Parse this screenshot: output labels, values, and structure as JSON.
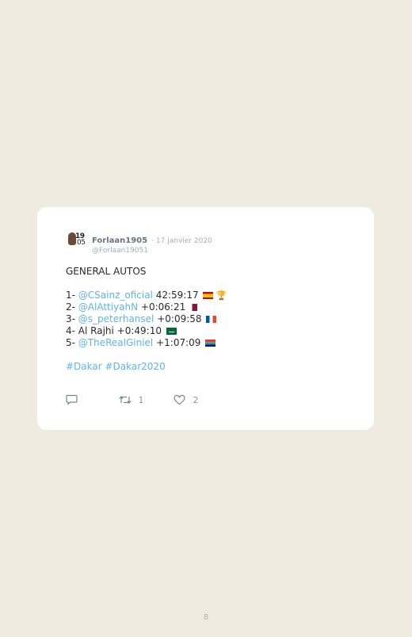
{
  "tweet": {
    "avatar_text_line1": "19",
    "avatar_text_line2": "05",
    "username": "Forlaan1905",
    "date": "· 17 janvier 2020",
    "handle": "@Forlaan19051",
    "title": "GENERAL AUTOS",
    "rows": [
      {
        "prefix": "1- ",
        "mention": "@CSainz_oficial",
        "time": " 42:59:17",
        "flag": "spain-flag",
        "extra": "trophy"
      },
      {
        "prefix": "2- ",
        "mention": "@AlAttiyahN",
        "time": " +0:06:21",
        "flag": "qatar-flag"
      },
      {
        "prefix": "3- ",
        "mention": "@s_peterhansel",
        "time": " +0:09:58",
        "flag": "france-flag"
      },
      {
        "prefix": "4- Al Rajhi",
        "mention": "",
        "time": " +0:49:10",
        "flag": "saudi-arabia-flag"
      },
      {
        "prefix": "5- ",
        "mention": "@TheRealGiniel",
        "time": " +1:07:09",
        "flag": "south-africa-flag"
      }
    ],
    "hashtags": "#Dakar #Dakar2020",
    "actions": {
      "reply_icon": "reply-icon",
      "retweet_icon": "retweet-icon",
      "retweet_count": "1",
      "like_icon": "heart-icon",
      "like_count": "2"
    },
    "colors": {
      "background": "#f0ebe1",
      "card": "#ffffff",
      "link": "#5fb4e6",
      "muted": "#a7adb3"
    }
  },
  "page_number": "8"
}
